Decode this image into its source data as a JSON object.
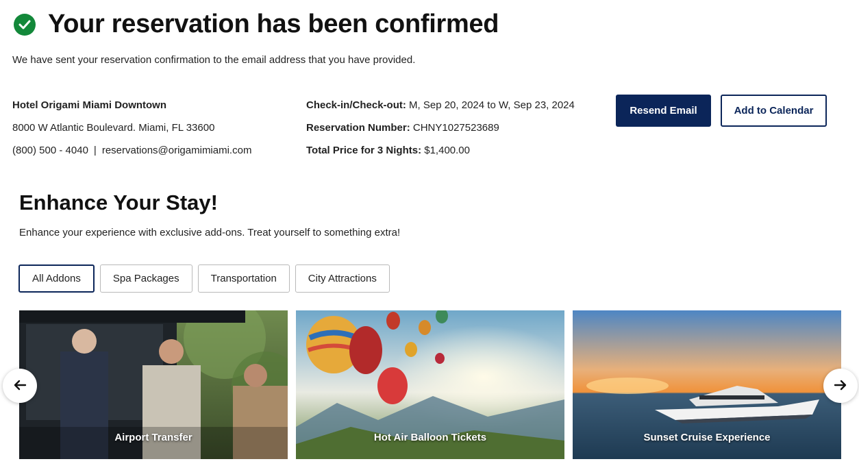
{
  "header": {
    "title": "Your reservation has been confirmed",
    "subtitle": "We have sent your reservation confirmation to the email address that you have provided.",
    "status_color": "#13883a"
  },
  "hotel": {
    "name": "Hotel Origami Miami Downtown",
    "address": "8000 W Atlantic Boulevard. Miami, FL 33600",
    "phone": "(800) 500 - 4040",
    "separator": "|",
    "email": "reservations@origamimiami.com"
  },
  "reservation": {
    "dates_label": "Check-in/Check-out:",
    "dates_value": "M, Sep 20, 2024 to W, Sep 23, 2024",
    "number_label": "Reservation Number:",
    "number_value": "CHNY1027523689",
    "price_label": "Total Price for 3 Nights:",
    "price_value": "$1,400.00"
  },
  "actions": {
    "resend": "Resend Email",
    "calendar": "Add to Calendar",
    "accent": "#0b2559"
  },
  "enhance": {
    "title": "Enhance Your Stay!",
    "description": "Enhance your experience with exclusive add-ons. Treat yourself to something extra!",
    "filters": [
      "All Addons",
      "Spa Packages",
      "Transportation",
      "City Attractions"
    ],
    "active_filter": "All Addons",
    "cards": [
      "Airport Transfer",
      "Hot Air Balloon Tickets",
      "Sunset Cruise Experience"
    ]
  },
  "icons": {
    "status": "check-circle-icon",
    "prev": "arrow-left-icon",
    "next": "arrow-right-icon"
  }
}
